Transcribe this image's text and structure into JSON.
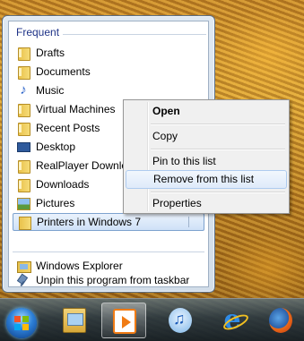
{
  "jumplist": {
    "section_header": "Frequent",
    "items": [
      {
        "label": "Drafts",
        "icon": "folder-icon"
      },
      {
        "label": "Documents",
        "icon": "folder-icon"
      },
      {
        "label": "Music",
        "icon": "music-icon"
      },
      {
        "label": "Virtual Machines",
        "icon": "folder-icon"
      },
      {
        "label": "Recent Posts",
        "icon": "folder-icon"
      },
      {
        "label": "Desktop",
        "icon": "desktop-icon"
      },
      {
        "label": "RealPlayer Downloads",
        "icon": "folder-icon"
      },
      {
        "label": "Downloads",
        "icon": "folder-icon"
      },
      {
        "label": "Pictures",
        "icon": "pictures-icon"
      },
      {
        "label": "Printers in Windows 7",
        "icon": "folder-icon",
        "selected": true
      }
    ],
    "tasks": [
      {
        "label": "Windows Explorer",
        "icon": "windows-explorer-icon"
      },
      {
        "label": "Unpin this program from taskbar",
        "icon": "unpin-icon"
      }
    ]
  },
  "context_menu": {
    "items": [
      {
        "label": "Open",
        "bold": true
      },
      {
        "label": "Copy"
      },
      {
        "label": "Pin to this list"
      },
      {
        "label": "Remove from this list",
        "highlighted": true
      },
      {
        "label": "Properties"
      }
    ]
  },
  "taskbar": {
    "buttons": [
      {
        "name": "start-button",
        "icon": "windows-orb-icon"
      },
      {
        "name": "libraries-button",
        "icon": "windows-explorer-icon"
      },
      {
        "name": "media-player-button",
        "icon": "media-player-icon",
        "active": true
      },
      {
        "name": "itunes-button",
        "icon": "itunes-icon"
      },
      {
        "name": "internet-explorer-button",
        "icon": "internet-explorer-icon"
      },
      {
        "name": "firefox-button",
        "icon": "firefox-icon"
      }
    ]
  },
  "colors": {
    "header_text": "#1e3287",
    "selection_border": "#7da2ce",
    "menu_highlight_border": "#aecbef"
  }
}
